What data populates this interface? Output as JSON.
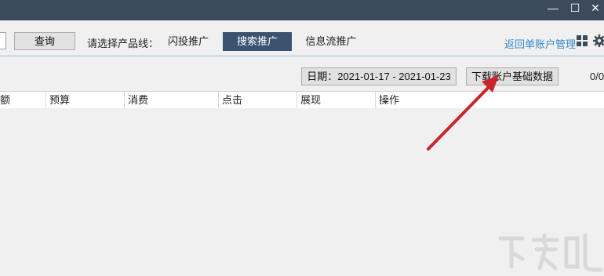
{
  "window": {
    "minimize_glyph": "—",
    "maximize_glyph": "☐",
    "close_glyph": "✕"
  },
  "toolbar": {
    "query_label": "查询",
    "product_line_label": "请选择产品线：",
    "tabs": [
      {
        "label": "闪投推广",
        "active": false
      },
      {
        "label": "搜索推广",
        "active": true
      },
      {
        "label": "信息流推广",
        "active": false
      }
    ],
    "return_link": "返回单账户管理"
  },
  "filter": {
    "date_range": "日期：2021-01-17 - 2021-01-23",
    "download_label": "下载账户基础数据",
    "page_count": "0/0"
  },
  "table": {
    "columns": [
      "额",
      "预算",
      "消费",
      "点击",
      "展现",
      "操作"
    ]
  },
  "colors": {
    "titlebar": "#3b4a5c",
    "active_tab": "#3b5370",
    "link": "#3b87c8",
    "arrow": "#c8262b"
  },
  "icons": {
    "grid": "grid-icon",
    "gear": "gear-icon"
  }
}
